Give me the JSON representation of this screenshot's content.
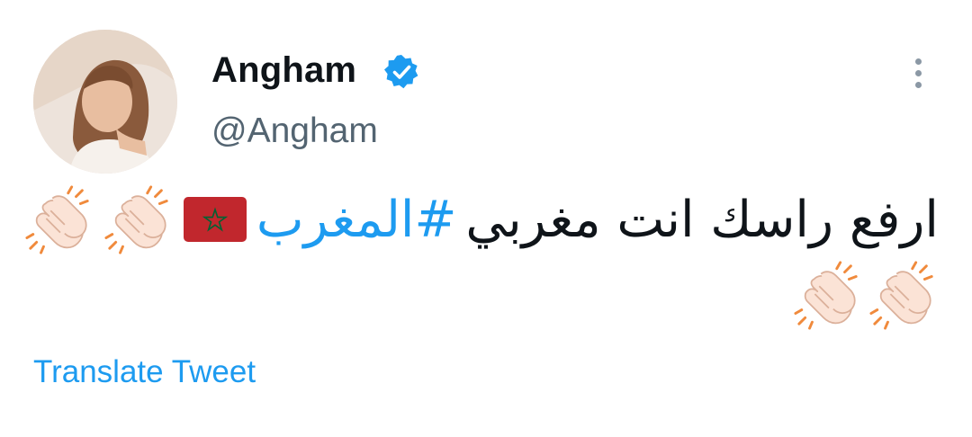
{
  "author": {
    "display_name": "Angham",
    "handle": "@Angham",
    "verified_icon": "verified-badge-icon",
    "avatar_icon": "profile-photo"
  },
  "tweet": {
    "text": "ارفع راسك انت مغربي",
    "hashtag": "#المغرب",
    "emojis": [
      "morocco-flag-icon",
      "clapping-hands-icon",
      "clapping-hands-icon",
      "clapping-hands-icon",
      "clapping-hands-icon"
    ]
  },
  "actions": {
    "translate_label": "Translate Tweet",
    "more_icon": "more-options-icon"
  },
  "colors": {
    "accent": "#1d9bf0",
    "text": "#0f1419",
    "secondary_text": "#536471",
    "flag_red": "#c1272d",
    "flag_star": "#006233"
  }
}
